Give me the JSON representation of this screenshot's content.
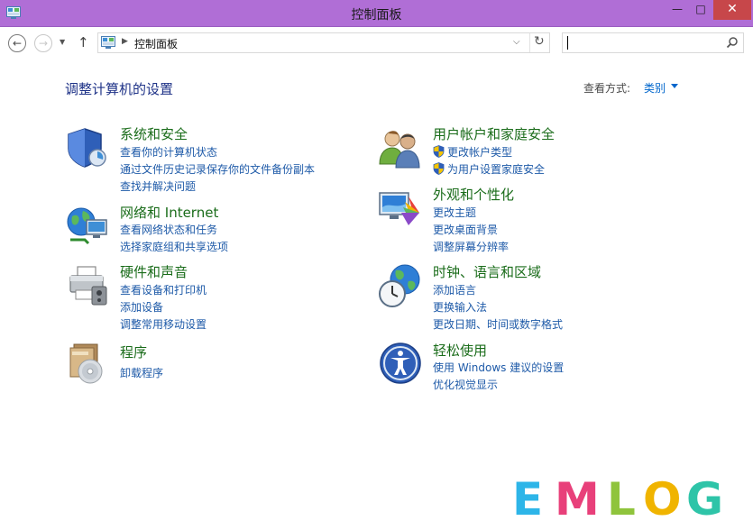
{
  "window": {
    "title": "控制面板",
    "controls": {
      "minimize": "—",
      "maximize": "□",
      "close": "✕"
    }
  },
  "navigation": {
    "back_icon": "back-arrow-icon",
    "forward_icon": "forward-arrow-icon",
    "recent_icon": "chevron-down-icon",
    "up_icon": "up-arrow-icon",
    "address": {
      "icon": "control-panel-icon",
      "path": "控制面板"
    },
    "search": {
      "value": "",
      "placeholder": ""
    }
  },
  "main": {
    "heading": "调整计算机的设置",
    "view_by": {
      "label": "查看方式:",
      "value": "类别"
    },
    "categories": [
      {
        "id": "system-security",
        "icon": "shield-security-icon",
        "title": "系统和安全",
        "links": [
          "查看你的计算机状态",
          "通过文件历史记录保存你的文件备份副本",
          "查找并解决问题"
        ]
      },
      {
        "id": "network-internet",
        "icon": "network-globe-icon",
        "title": "网络和 Internet",
        "links": [
          "查看网络状态和任务",
          "选择家庭组和共享选项"
        ]
      },
      {
        "id": "hardware-sound",
        "icon": "printer-speaker-icon",
        "title": "硬件和声音",
        "links": [
          "查看设备和打印机",
          "添加设备",
          "调整常用移动设置"
        ]
      },
      {
        "id": "programs",
        "icon": "programs-disc-icon",
        "title": "程序",
        "links": [
          "卸载程序"
        ]
      },
      {
        "id": "user-accounts",
        "icon": "users-icon",
        "title": "用户帐户和家庭安全",
        "links": [
          "更改帐户类型",
          "为用户设置家庭安全"
        ]
      },
      {
        "id": "appearance",
        "icon": "monitor-palette-icon",
        "title": "外观和个性化",
        "links": [
          "更改主题",
          "更改桌面背景",
          "调整屏幕分辨率"
        ]
      },
      {
        "id": "clock-language-region",
        "icon": "clock-globe-icon",
        "title": "时钟、语言和区域",
        "links": [
          "添加语言",
          "更换输入法",
          "更改日期、时间或数字格式"
        ]
      },
      {
        "id": "ease-of-access",
        "icon": "ease-of-access-icon",
        "title": "轻松使用",
        "links": [
          "使用 Windows 建议的设置",
          "优化视觉显示"
        ]
      }
    ]
  },
  "watermark": {
    "letters": [
      "E",
      "M",
      "L",
      "O",
      "G"
    ],
    "colors": [
      "#2db5e8",
      "#e8407a",
      "#8fc43c",
      "#f0b400",
      "#2ec4a8"
    ]
  },
  "colors": {
    "titlebar": "#b06ed6",
    "close_button": "#c7474a",
    "heading": "#1e3287",
    "category_title": "#1a6c1a",
    "link": "#1e5aa8"
  }
}
